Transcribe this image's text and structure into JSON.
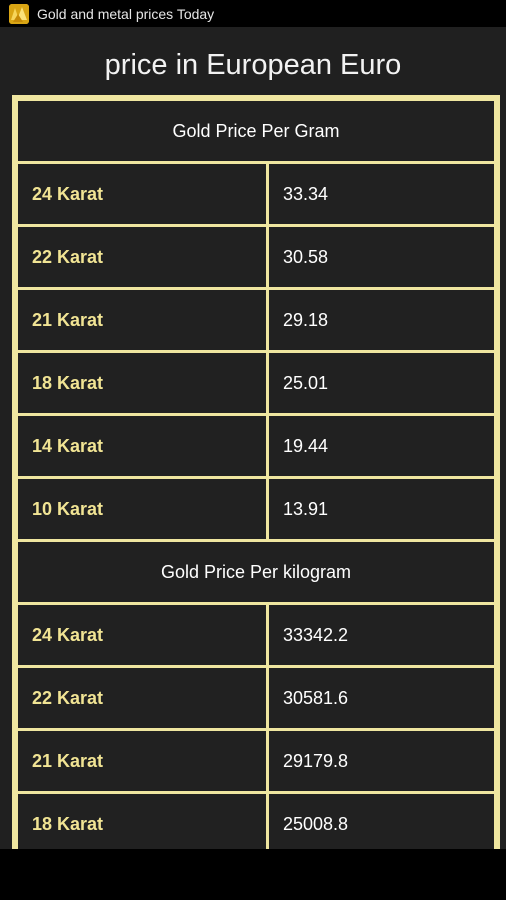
{
  "titlebar": {
    "title": "Gold and metal prices Today",
    "icon": "gold-bars-icon"
  },
  "heading": "price in European Euro",
  "colors": {
    "accent": "#efe6a0",
    "label": "#f1e494",
    "cell_bg": "#212121",
    "page_bg": "#202020"
  },
  "sections": [
    {
      "title": "Gold Price Per Gram",
      "rows": [
        {
          "label": "24 Karat",
          "value": "33.34"
        },
        {
          "label": "22 Karat",
          "value": "30.58"
        },
        {
          "label": "21 Karat",
          "value": "29.18"
        },
        {
          "label": "18 Karat",
          "value": "25.01"
        },
        {
          "label": "14 Karat",
          "value": "19.44"
        },
        {
          "label": "10 Karat",
          "value": "13.91"
        }
      ]
    },
    {
      "title": "Gold Price Per kilogram",
      "rows": [
        {
          "label": "24 Karat",
          "value": "33342.2"
        },
        {
          "label": "22 Karat",
          "value": "30581.6"
        },
        {
          "label": "21 Karat",
          "value": "29179.8"
        },
        {
          "label": "18 Karat",
          "value": "25008.8"
        }
      ]
    }
  ]
}
